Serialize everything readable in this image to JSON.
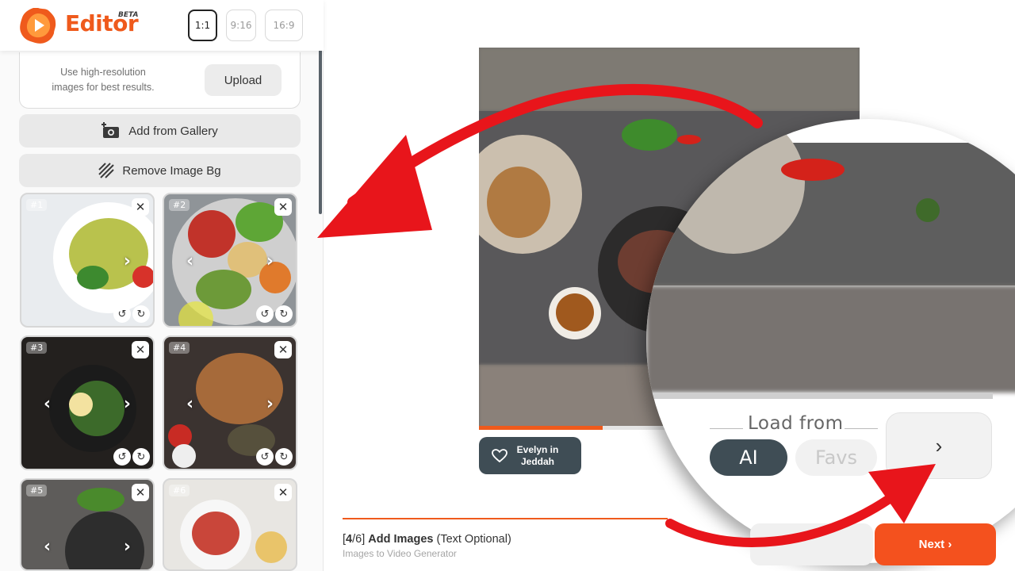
{
  "header": {
    "brand": "Editor",
    "badge": "BETA",
    "ratios": [
      "1:1",
      "9:16",
      "16:9"
    ],
    "selected_ratio": "1:1"
  },
  "upload": {
    "hint": "Use high-resolution images for best results.",
    "button": "Upload"
  },
  "actions": {
    "gallery": "Add from Gallery",
    "remove_bg": "Remove Image Bg"
  },
  "images": [
    {
      "label": "#1"
    },
    {
      "label": "#2"
    },
    {
      "label": "#3"
    },
    {
      "label": "#4"
    },
    {
      "label": "#5"
    },
    {
      "label": "#6"
    }
  ],
  "preview": {
    "progress": 0.325,
    "credit": "Evelyn in Jeddah"
  },
  "load_from": {
    "title": "Load from",
    "options": [
      "AI",
      "Favs"
    ],
    "selected": "AI"
  },
  "footer": {
    "step_current": "4",
    "step_total": "/6",
    "step_title": "Add Images",
    "step_note": "(Text Optional)",
    "subtitle": "Images to Video Generator",
    "next": "Next"
  },
  "colors": {
    "accent": "#ef5a1c",
    "dark": "#3f4d55",
    "annotation": "#e8151b"
  }
}
